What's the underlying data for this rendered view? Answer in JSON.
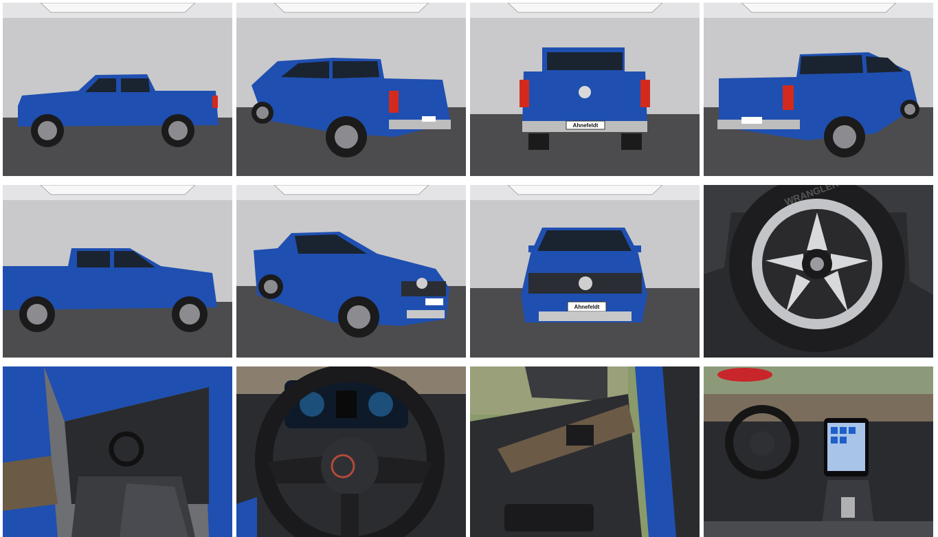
{
  "gallery": {
    "photos": [
      {
        "view": "side-left"
      },
      {
        "view": "rear-three-quarter-left"
      },
      {
        "view": "rear"
      },
      {
        "view": "rear-three-quarter-right"
      },
      {
        "view": "side-right"
      },
      {
        "view": "front-three-quarter-right"
      },
      {
        "view": "front"
      },
      {
        "view": "wheel-closeup",
        "tire_text": "WRANGLER"
      },
      {
        "view": "interior-door-open"
      },
      {
        "view": "steering-wheel-dashboard"
      },
      {
        "view": "door-panel"
      },
      {
        "view": "interior-cockpit"
      }
    ],
    "plate_text": "Ahnefeldt",
    "colors": {
      "body_blue": "#1f4fb0",
      "studio_wall": "#c9c9cb",
      "studio_floor": "#4a4a4c",
      "taillight": "#d42a1e"
    }
  }
}
